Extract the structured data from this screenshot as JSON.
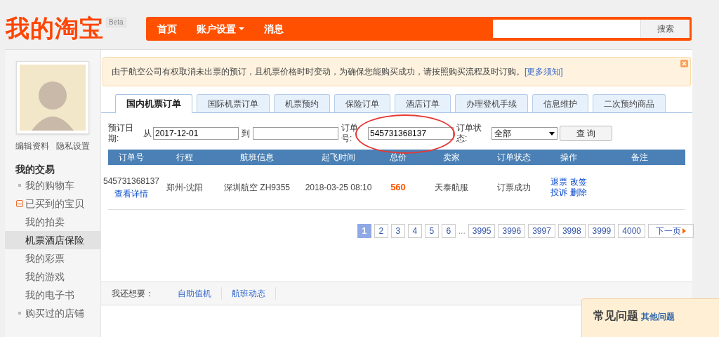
{
  "header": {
    "logo": "我的淘宝",
    "badge": "Beta",
    "nav": [
      {
        "label": "首页",
        "dropdown": false
      },
      {
        "label": "账户设置",
        "dropdown": true
      },
      {
        "label": "消息",
        "dropdown": false
      }
    ],
    "search": {
      "button": "搜索"
    }
  },
  "sidebar": {
    "links": [
      "编辑资料",
      "隐私设置"
    ],
    "section_title": "我的交易",
    "items": [
      {
        "label": "我的购物车",
        "kind": "bullet",
        "selected": false
      },
      {
        "label": "已买到的宝贝",
        "kind": "expander",
        "selected": false
      },
      {
        "label": "我的拍卖",
        "kind": "plain",
        "selected": false
      },
      {
        "label": "机票酒店保险",
        "kind": "plain",
        "selected": true
      },
      {
        "label": "我的彩票",
        "kind": "plain",
        "selected": false
      },
      {
        "label": "我的游戏",
        "kind": "plain",
        "selected": false
      },
      {
        "label": "我的电子书",
        "kind": "plain",
        "selected": false
      },
      {
        "label": "购买过的店铺",
        "kind": "bullet",
        "selected": false
      }
    ]
  },
  "notice": {
    "text": "由于航空公司有权取消未出票的预订，且机票价格时时变动，为确保您能购买成功，请按照购买流程及时订购。",
    "link": "[更多须知]"
  },
  "tabs": [
    {
      "label": "国内机票订单",
      "selected": true
    },
    {
      "label": "国际机票订单",
      "selected": false
    },
    {
      "label": "机票预约",
      "selected": false
    },
    {
      "label": "保险订单",
      "selected": false
    },
    {
      "label": "酒店订单",
      "selected": false
    },
    {
      "label": "办理登机手续",
      "selected": false
    },
    {
      "label": "信息维护",
      "selected": false
    },
    {
      "label": "二次预约商品",
      "selected": false
    }
  ],
  "filters": {
    "date_label": "预订日期:",
    "from_label": "从",
    "from_value": "2017-12-01",
    "to_label": "到",
    "order_label": "订单号:",
    "order_value": "545731368137",
    "status_label": "订单状态:",
    "status_value": "全部",
    "query_button": "查 询"
  },
  "table": {
    "columns": [
      "订单号",
      "行程",
      "航班信息",
      "起飞时间",
      "总价",
      "卖家",
      "订单状态",
      "操作",
      "备注"
    ],
    "rows": [
      {
        "order_no": "545731368137",
        "detail_link": "查看详情",
        "route": "郑州-沈阳",
        "flight": "深圳航空 ZH9355",
        "departure": "2018-03-25 08:10",
        "price": "560",
        "seller": "天泰航服",
        "status": "订票成功",
        "actions": [
          "退票",
          "改签",
          "投诉",
          "删除"
        ]
      }
    ]
  },
  "pagination": {
    "pages": [
      {
        "label": "1",
        "selected": true
      },
      {
        "label": "2",
        "selected": false
      },
      {
        "label": "3",
        "selected": false
      },
      {
        "label": "4",
        "selected": false
      },
      {
        "label": "5",
        "selected": false
      },
      {
        "label": "6",
        "selected": false
      }
    ],
    "ellipsis": "...",
    "end_pages": [
      {
        "label": "3995",
        "selected": false
      },
      {
        "label": "3996",
        "selected": false
      },
      {
        "label": "3997",
        "selected": false
      },
      {
        "label": "3998",
        "selected": false
      },
      {
        "label": "3999",
        "selected": false
      },
      {
        "label": "4000",
        "selected": false
      }
    ],
    "next": "下一页"
  },
  "also_want": {
    "label": "我还想要：",
    "links": [
      "自助值机",
      "航班动态"
    ]
  },
  "faq": {
    "title": "常见问题",
    "link": "其他问题"
  }
}
